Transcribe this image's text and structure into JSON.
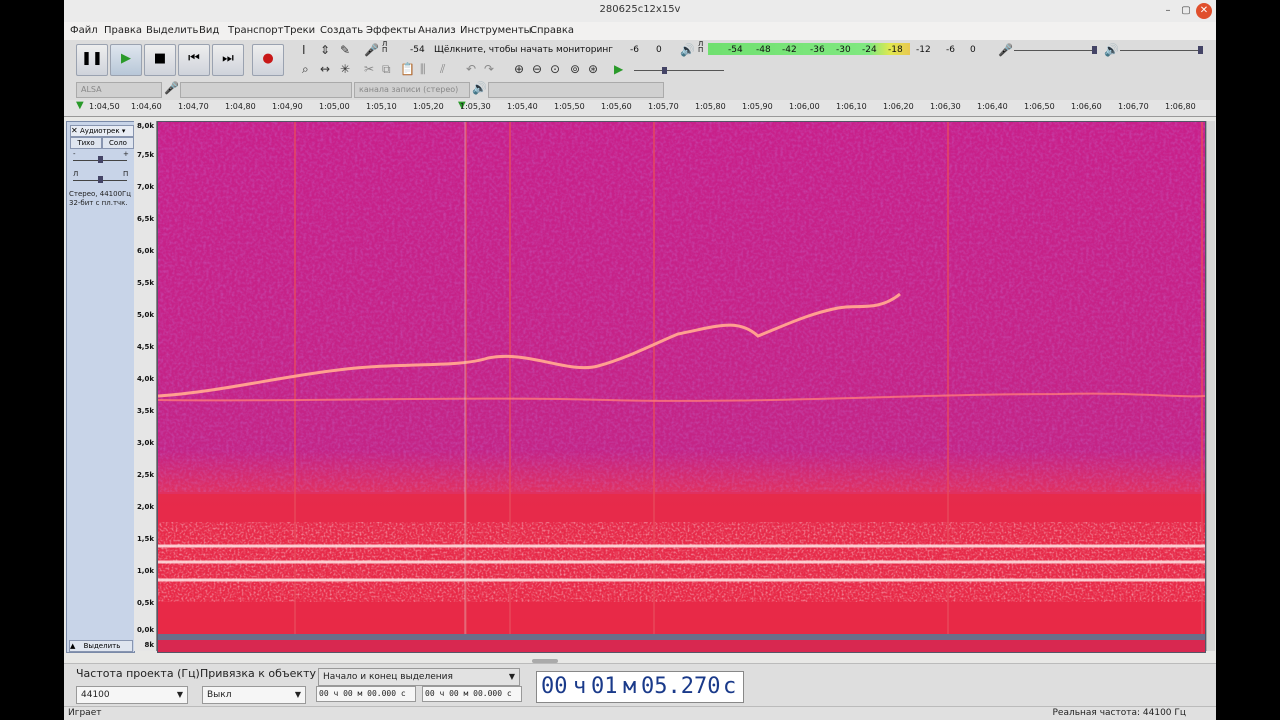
{
  "window": {
    "title": "280625c12x15v"
  },
  "menu": [
    "Файл",
    "Правка",
    "Выделить",
    "Вид",
    "Транспорт",
    "Треки",
    "Создать",
    "Эффекты",
    "Анализ",
    "Инструменты",
    "Справка"
  ],
  "meter": {
    "rec_scale": [
      "-54",
      "-6",
      "0"
    ],
    "rec_hint": "Щёлкните, чтобы начать мониторинг",
    "play_scale": [
      "-54",
      "-48",
      "-42",
      "-36",
      "-30",
      "-24",
      "-18",
      "-12",
      "-6",
      "0"
    ],
    "lp_top": "Л",
    "lp_bottom": "П"
  },
  "device": {
    "host": "ALSA",
    "channels": "канала записи (стерео)"
  },
  "ruler": [
    "1:04,50",
    "1:04,60",
    "1:04,70",
    "1:04,80",
    "1:04,90",
    "1:05,00",
    "1:05,10",
    "1:05,20",
    "1:05,30",
    "1:05,40",
    "1:05,50",
    "1:05,60",
    "1:05,70",
    "1:05,80",
    "1:05,90",
    "1:06,00",
    "1:06,10",
    "1:06,20",
    "1:06,30",
    "1:06,40",
    "1:06,50",
    "1:06,60",
    "1:06,70",
    "1:06,80"
  ],
  "track": {
    "name": "Аудиотрек",
    "mute": "Тихо",
    "solo": "Соло",
    "gain_minus": "-",
    "gain_plus": "+",
    "pan_l": "Л",
    "pan_r": "П",
    "info1": "Стерео, 44100Гц",
    "info2": "32-бит с пл.тчк.",
    "select": "Выделить",
    "freq_labels": [
      "8,0k",
      "7,5k",
      "7,0k",
      "6,5k",
      "6,0k",
      "5,5k",
      "5,0k",
      "4,5k",
      "4,0k",
      "3,5k",
      "3,0k",
      "2,5k",
      "2,0k",
      "1,5k",
      "1,0k",
      "0,5k",
      "0,0k"
    ],
    "lower_label": "8k"
  },
  "bottom": {
    "rate_label": "Частота проекта (Гц)",
    "rate_value": "44100",
    "snap_label": "Привязка к объекту",
    "snap_value": "Выкл",
    "sel_mode": "Начало и конец выделения",
    "sel_start": "00 ч 00 м 00.000 с",
    "sel_end": "00 ч 00 м 00.000 с",
    "time_h": "00",
    "time_hu": "ч",
    "time_m": "01",
    "time_mu": "м",
    "time_s": "05.270",
    "time_su": "с"
  },
  "status": {
    "left": "Играет",
    "right": "Реальная частота: 44100 Гц"
  }
}
